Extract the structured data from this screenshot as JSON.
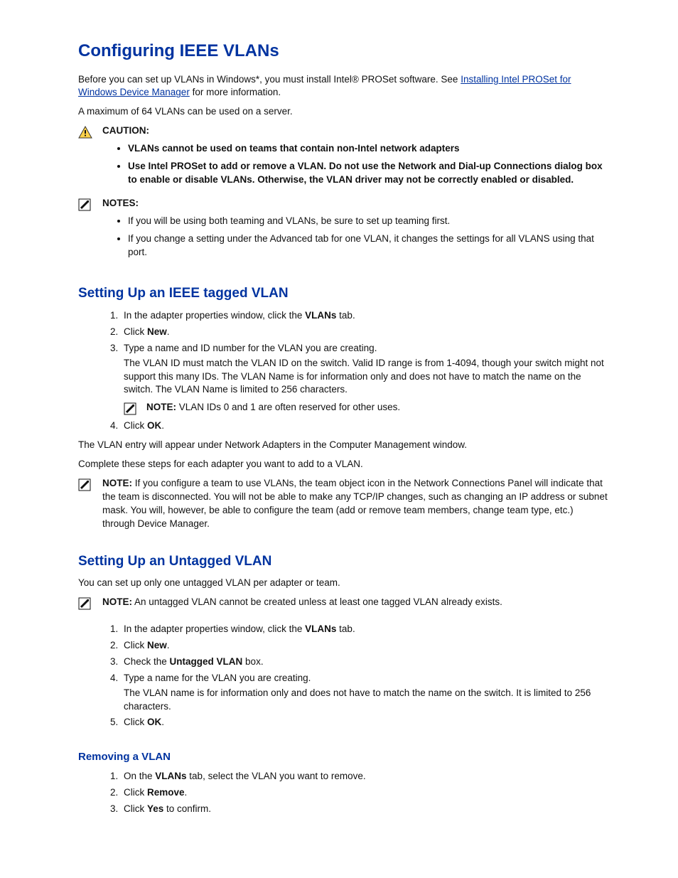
{
  "h1": "Configuring IEEE VLANs",
  "intro": {
    "pre": "Before you can set up VLANs in Windows*, you must install Intel® PROSet software. See ",
    "link": "Installing Intel PROSet for Windows Device Manager",
    "post": " for more information."
  },
  "maxline": "A maximum of 64 VLANs can be used on a server.",
  "caution": {
    "label": "CAUTION:",
    "items": [
      "VLANs cannot be used on teams that contain non-Intel network adapters",
      "Use Intel PROSet to add or remove a VLAN. Do not use the Network and Dial-up Connections dialog box to enable or disable VLANs. Otherwise, the VLAN driver may not be correctly enabled or disabled."
    ]
  },
  "notes1": {
    "label": "NOTES:",
    "items": [
      "If you will be using both teaming and VLANs, be sure to set up teaming first.",
      "If you change a setting under the Advanced tab for one VLAN, it changes the settings for all VLANS using that port."
    ]
  },
  "h2a": "Setting Up an IEEE tagged VLAN",
  "tagged": {
    "s1a": "In the adapter properties window, click the ",
    "s1b": "VLANs",
    "s1c": " tab.",
    "s2a": "Click ",
    "s2b": "New",
    "s2c": ".",
    "s3a": "Type a name and ID number for the VLAN you are creating.",
    "s3sub": " The VLAN ID must match the VLAN ID on the switch. Valid ID range is from 1-4094, though your switch might not support this many IDs. The VLAN Name is for information only and does not have to match the name on the switch. The VLAN Name is limited to 256 characters.",
    "s3note_label": "NOTE:",
    "s3note_text": " VLAN IDs 0 and 1 are often reserved for other uses.",
    "s4a": "Click ",
    "s4b": "OK",
    "s4c": "."
  },
  "after_tagged_1": "The VLAN entry will appear under Network Adapters in the Computer Management window.",
  "after_tagged_2": "Complete these steps for each adapter you want to add to a VLAN.",
  "team_note": {
    "label": "NOTE:",
    "text": " If you configure a team to use VLANs, the team object icon in the Network Connections Panel will indicate that the team is disconnected. You will not be able to make any TCP/IP changes, such as changing an IP address or subnet mask. You will, however, be able to configure the team (add or remove team members, change team type, etc.) through Device Manager."
  },
  "h2b": "Setting Up an Untagged VLAN",
  "untagged_intro": "You can set up only one untagged VLAN per adapter or team.",
  "untagged_note": {
    "label": "NOTE:",
    "text": " An untagged VLAN cannot be created unless at least one tagged VLAN already exists."
  },
  "untagged": {
    "s1a": "In the adapter properties window, click the ",
    "s1b": "VLANs",
    "s1c": " tab.",
    "s2a": "Click ",
    "s2b": "New",
    "s2c": ".",
    "s3a": "Check the ",
    "s3b": "Untagged VLAN",
    "s3c": " box.",
    "s4a": "Type a name for the VLAN you are creating.",
    "s4sub": " The VLAN name is for information only and does not have to match the name on the switch. It is limited to 256 characters.",
    "s5a": "Click ",
    "s5b": "OK",
    "s5c": "."
  },
  "h3": "Removing a VLAN",
  "remove": {
    "s1a": "On the ",
    "s1b": "VLANs",
    "s1c": " tab, select the VLAN you want to remove.",
    "s2a": "Click ",
    "s2b": "Remove",
    "s2c": ".",
    "s3a": "Click ",
    "s3b": "Yes",
    "s3c": " to confirm."
  }
}
